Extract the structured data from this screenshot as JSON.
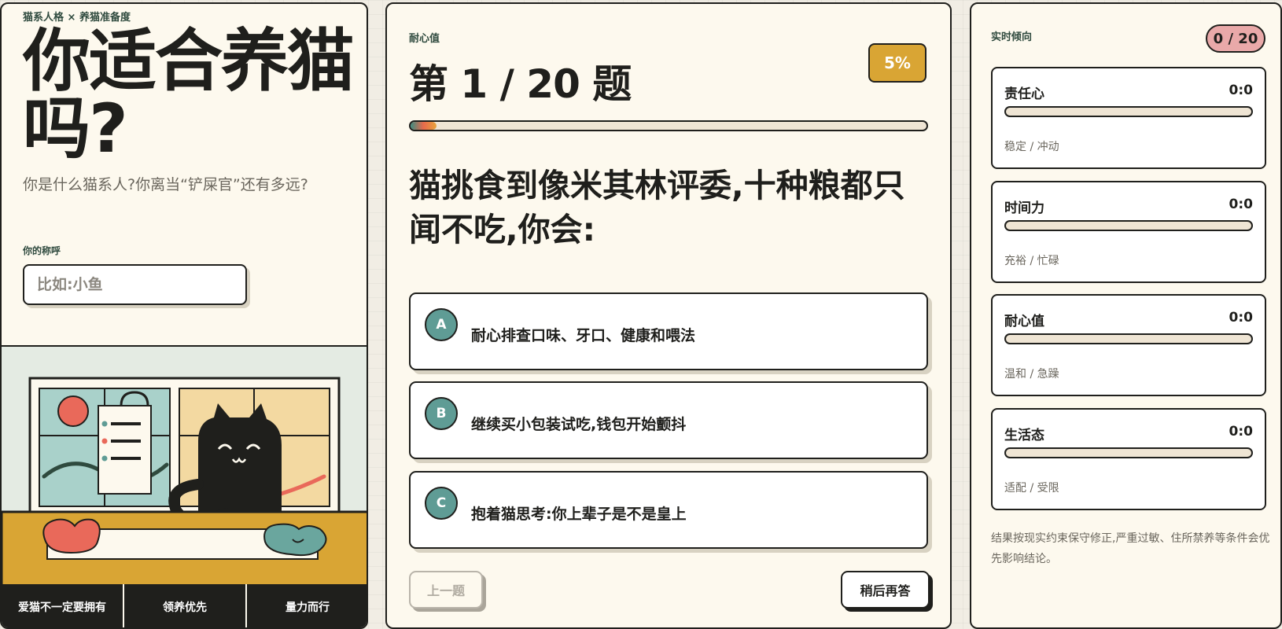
{
  "left": {
    "eyebrow": "猫系人格 × 养猫准备度",
    "title": "你适合养猫吗?",
    "subtitle": "你是什么猫系人?你离当“铲屎官”还有多远?",
    "name_label": "你的称呼",
    "name_placeholder": "比如:小鱼",
    "name_value": "",
    "tags": [
      "爱猫不一定要拥有",
      "领养优先",
      "量力而行"
    ]
  },
  "quiz": {
    "label": "耐心值",
    "counter": "第 1 / 20 题",
    "percent_label": "5%",
    "progress": 0.05,
    "question": "猫挑食到像米其林评委,十种粮都只闻不吃,你会:",
    "options": [
      {
        "letter": "A",
        "text": "耐心排查口味、牙口、健康和喂法"
      },
      {
        "letter": "B",
        "text": "继续买小包装试吃,钱包开始颤抖"
      },
      {
        "letter": "C",
        "text": "抱着猫思考:你上辈子是不是皇上"
      }
    ],
    "prev_label": "上一题",
    "later_label": "稍后再答"
  },
  "tendency": {
    "label": "实时倾向",
    "answered": "0 / 20",
    "traits": [
      {
        "name": "责任心",
        "score": "0:0",
        "level": 0,
        "poles": "稳定 / 冲动"
      },
      {
        "name": "时间力",
        "score": "0:0",
        "level": 0,
        "poles": "充裕 / 忙碌"
      },
      {
        "name": "耐心值",
        "score": "0:0",
        "level": 0,
        "poles": "温和 / 急躁"
      },
      {
        "name": "生活态",
        "score": "0:0",
        "level": 0,
        "poles": "适配 / 受限"
      }
    ],
    "footnote": "结果按现实约束保守修正,严重过敏、住所禁养等条件会优先影响结论。"
  },
  "colors": {
    "accent_gold": "#d9a534",
    "teal": "#5f9c95",
    "coral": "#e9695a",
    "ink": "#1f1f1c",
    "cream": "#fdf9ee",
    "badge_pink": "#e9a9a9"
  }
}
